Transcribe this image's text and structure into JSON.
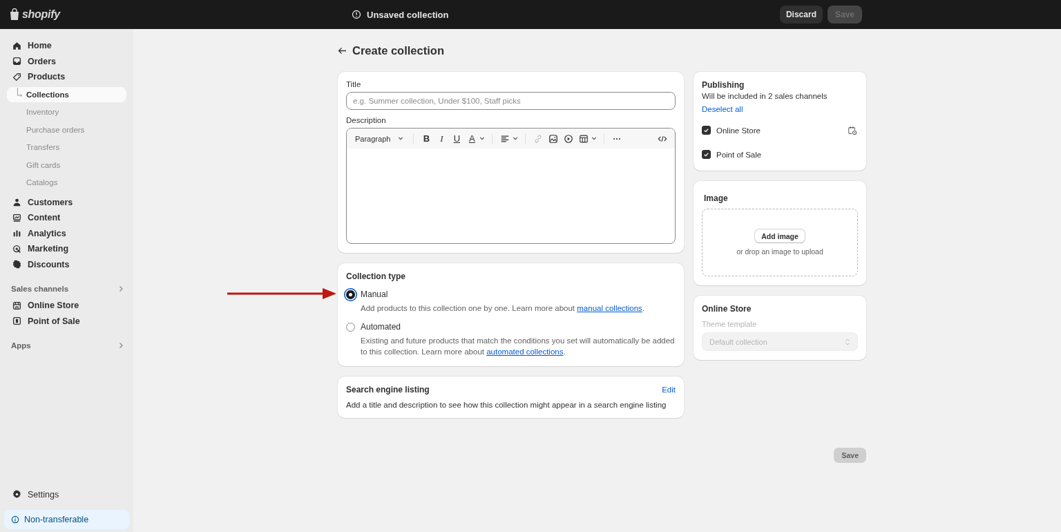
{
  "topbar": {
    "logo": "shopify",
    "status": "Unsaved collection",
    "buttons": [
      {
        "label": "Discard",
        "disabled": false
      },
      {
        "label": "Save",
        "disabled": true
      }
    ]
  },
  "sidebar": {
    "items": [
      {
        "label": "Home",
        "selected": false
      },
      {
        "label": "Orders",
        "selected": false
      },
      {
        "label": "Products",
        "selected": false,
        "children": [
          {
            "label": "Collections",
            "selected": true
          },
          {
            "label": "Inventory",
            "selected": false
          },
          {
            "label": "Purchase orders",
            "selected": false
          },
          {
            "label": "Transfers",
            "selected": false
          },
          {
            "label": "Gift cards",
            "selected": false
          },
          {
            "label": "Catalogs",
            "selected": false
          }
        ]
      },
      {
        "label": "Customers",
        "selected": false
      },
      {
        "label": "Content",
        "selected": false
      },
      {
        "label": "Analytics",
        "selected": false
      },
      {
        "label": "Marketing",
        "selected": false
      },
      {
        "label": "Discounts",
        "selected": false
      }
    ],
    "sections": [
      {
        "label": "Sales channels",
        "items": [
          {
            "label": "Online Store",
            "selected": false
          },
          {
            "label": "Point of Sale",
            "selected": false
          }
        ]
      },
      {
        "label": "Apps"
      }
    ],
    "settings": "Settings",
    "notice": "Non-transferable"
  },
  "page": {
    "title": "Create collection",
    "details": {
      "title_label": "Title",
      "title_placeholder": "e.g. Summer collection, Under $100, Staff picks",
      "description_label": "Description",
      "paragraph_select": "Paragraph",
      "format_buttons": [
        "B",
        "I",
        "U",
        "A"
      ]
    },
    "collection_type": {
      "title": "Collection type",
      "options": [
        {
          "label": "Manual",
          "selected": true,
          "text": "Add products to this collection one by one. Learn more about",
          "link": "manual collections",
          "suffix": "."
        },
        {
          "label": "Automated",
          "selected": false,
          "text": "Existing and future products that match the conditions you set will automatically be added to this collection. Learn more about",
          "link": "automated collections",
          "suffix": "."
        }
      ]
    },
    "seo": {
      "title": "Search engine listing",
      "action": "Edit",
      "text": "Add a title and description to see how this collection might appear in a search engine listing"
    },
    "publishing": {
      "title": "Publishing",
      "subtitle": "Will be included in 2 sales channels",
      "action": "Deselect all",
      "channels": [
        {
          "label": "Online Store",
          "checked": true,
          "schedule": true
        },
        {
          "label": "Point of Sale",
          "checked": true,
          "schedule": false
        }
      ]
    },
    "image": {
      "title": "Image",
      "button": "Add image",
      "hint": "or drop an image to upload"
    },
    "online_store": {
      "title": "Online Store",
      "label": "Theme template",
      "value": "Default collection",
      "disabled": true
    },
    "save_button": {
      "label": "Save",
      "disabled": true
    }
  }
}
